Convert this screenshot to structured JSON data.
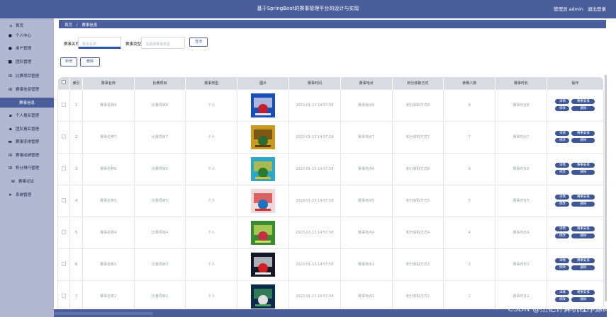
{
  "header": {
    "title": "基于SpringBoot的赛事管理平台的设计与实现",
    "user_label": "管理员 admin",
    "logout_label": "退出登录"
  },
  "sidebar": {
    "items": [
      {
        "label": "首页",
        "icon": "home-icon",
        "glyph": "⌂"
      },
      {
        "label": "个人中心",
        "icon": "user-icon",
        "glyph": "●"
      },
      {
        "label": "用户管理",
        "icon": "user-icon",
        "glyph": "●"
      },
      {
        "label": "团队管理",
        "icon": "team-icon",
        "glyph": "■"
      },
      {
        "label": "比赛项目管理",
        "icon": "grid-icon",
        "glyph": "⊞"
      },
      {
        "label": "赛事信息管理",
        "icon": "grid-icon",
        "glyph": "⊞"
      },
      {
        "label": "赛事信息",
        "icon": "",
        "glyph": ""
      },
      {
        "label": "个人报名管理",
        "icon": "comment-icon",
        "glyph": "▪"
      },
      {
        "label": "团队报名管理",
        "icon": "doc-icon",
        "glyph": "▪"
      },
      {
        "label": "赛事安排管理",
        "icon": "calendar-icon",
        "glyph": "▬"
      },
      {
        "label": "赛事成绩管理",
        "icon": "grid-icon",
        "glyph": "⊞"
      },
      {
        "label": "积分排行管理",
        "icon": "grid-icon",
        "glyph": "⊞"
      },
      {
        "label": "赛事论坛",
        "icon": "grid-icon",
        "glyph": "⊞"
      },
      {
        "label": "系统管理",
        "icon": "send-icon",
        "glyph": "➤"
      }
    ]
  },
  "breadcrumb": {
    "home": "首页",
    "sep": "/",
    "current": "赛事信息"
  },
  "search": {
    "name_label": "赛事名称",
    "name_placeholder": "赛事名称",
    "type_label": "赛事类型",
    "type_placeholder": "请选择赛事类型",
    "button": "查询"
  },
  "actions": {
    "add": "新增",
    "delete": "删除"
  },
  "table": {
    "columns": [
      "索引",
      "赛事名称",
      "比赛项目",
      "赛事类型",
      "图片",
      "赛事时间",
      "赛事地点",
      "积分获取方式",
      "参赛人数",
      "赛事时长",
      "操作"
    ],
    "ops": {
      "detail": "详情",
      "schedule": "赛事安排",
      "edit": "修改",
      "delete": "删除"
    },
    "rows": [
      {
        "index": "1",
        "name": "赛事名称8",
        "project": "比赛项目8",
        "type": "个人",
        "time": "2023-01-13 14:57:58",
        "place": "赛事地点8",
        "points": "积分获取方式8",
        "count": "8",
        "duration": "赛事时长8"
      },
      {
        "index": "2",
        "name": "赛事名称7",
        "project": "比赛项目7",
        "type": "个人",
        "time": "2023-01-13 14:57:58",
        "place": "赛事地点7",
        "points": "积分获取方式7",
        "count": "7",
        "duration": "赛事时长7"
      },
      {
        "index": "3",
        "name": "赛事名称6",
        "project": "比赛项目6",
        "type": "个人",
        "time": "2023-01-13 14:57:58",
        "place": "赛事地点6",
        "points": "积分获取方式6",
        "count": "6",
        "duration": "赛事时长6"
      },
      {
        "index": "4",
        "name": "赛事名称5",
        "project": "比赛项目5",
        "type": "个人",
        "time": "2023-01-13 14:57:58",
        "place": "赛事地点5",
        "points": "积分获取方式5",
        "count": "5",
        "duration": "赛事时长5"
      },
      {
        "index": "5",
        "name": "赛事名称4",
        "project": "比赛项目4",
        "type": "个人",
        "time": "2023-01-13 14:57:58",
        "place": "赛事地点4",
        "points": "积分获取方式4",
        "count": "4",
        "duration": "赛事时长4"
      },
      {
        "index": "6",
        "name": "赛事名称3",
        "project": "比赛项目3",
        "type": "个人",
        "time": "2023-01-13 14:57:58",
        "place": "赛事地点3",
        "points": "积分获取方式3",
        "count": "3",
        "duration": "赛事时长3"
      },
      {
        "index": "7",
        "name": "赛事名称2",
        "project": "比赛项目2",
        "type": "个人",
        "time": "2023-01-13 14:57:58",
        "place": "赛事地点2",
        "points": "积分获取方式2",
        "count": "2",
        "duration": "赛事时长2"
      }
    ]
  },
  "watermark": "CSDN @杰记计算机程序源码",
  "colors": {
    "primary": "#4a5e9b",
    "sidebar": "#b2b8d2",
    "header_row": "#d9dbe3"
  }
}
